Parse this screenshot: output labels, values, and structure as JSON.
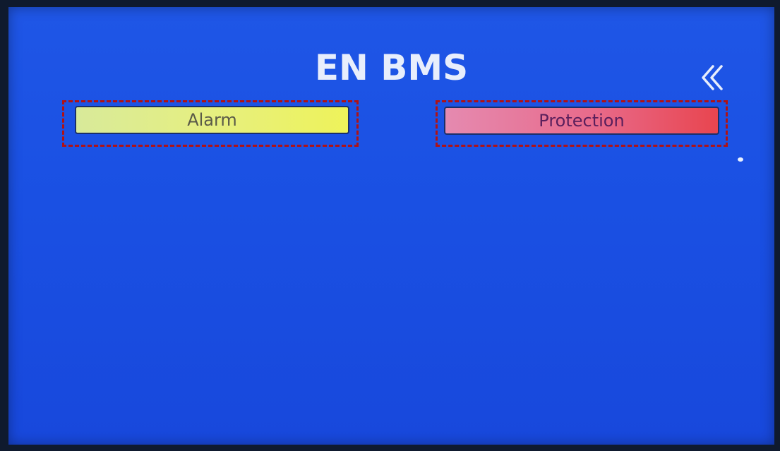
{
  "header": {
    "title": "EN BMS",
    "back_icon": "double-chevron-left-icon"
  },
  "buttons": {
    "alarm_label": "Alarm",
    "protection_label": "Protection"
  },
  "colors": {
    "screen_background": "#1a50e3",
    "alarm_button": "#e6ef80",
    "protection_button": "#e86a8a",
    "highlight_dash": "#b01214"
  }
}
